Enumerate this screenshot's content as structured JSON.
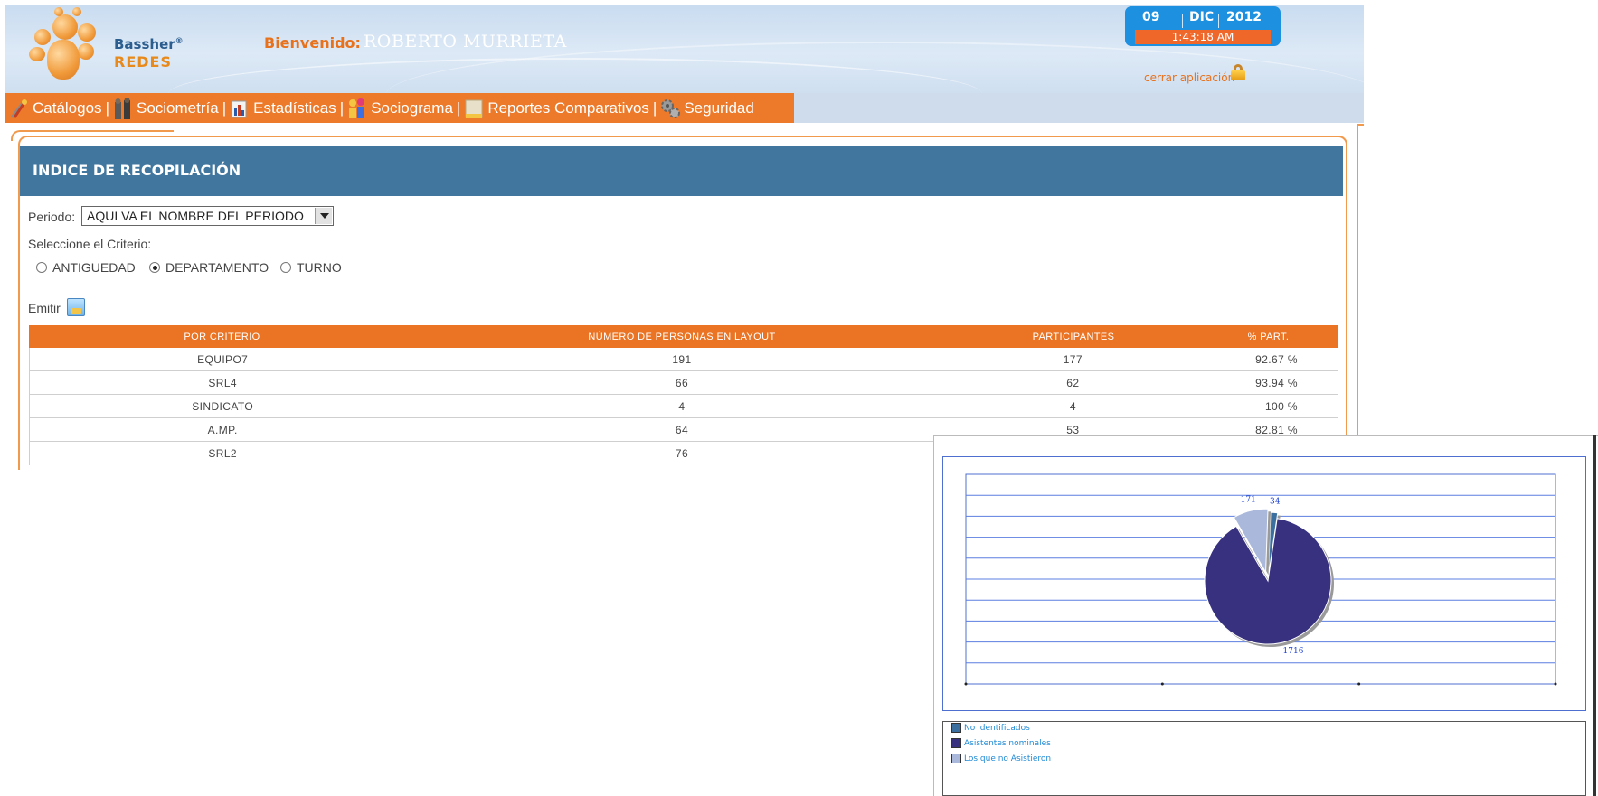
{
  "header": {
    "logo_line1": "Bassher",
    "logo_reg": "®",
    "logo_line2": "REDES",
    "welcome_label": "Bienvenido:",
    "user_name": "ROBERTO MURRIETA",
    "date": {
      "day": "09",
      "month": "DIC",
      "year": "2012",
      "time": "1:43:18 AM"
    },
    "close_label": "cerrar aplicación"
  },
  "nav": {
    "items": [
      {
        "label": "Catálogos",
        "icon": "tools-icon"
      },
      {
        "label": "Sociometría",
        "icon": "people-icon"
      },
      {
        "label": "Estadísticas",
        "icon": "bar-chart-icon"
      },
      {
        "label": "Sociograma",
        "icon": "group-icon"
      },
      {
        "label": "Reportes Comparativos",
        "icon": "report-icon"
      },
      {
        "label": "Seguridad",
        "icon": "gears-icon"
      }
    ]
  },
  "section": {
    "title": "INDICE DE RECOPILACIÓN"
  },
  "form": {
    "period_label": "Periodo:",
    "period_value": "AQUI VA EL NOMBRE DEL PERIODO",
    "criteria_label": "Seleccione el Criterio:",
    "criteria_options": [
      "ANTIGUEDAD",
      "DEPARTAMENTO",
      "TURNO"
    ],
    "criteria_selected": "DEPARTAMENTO",
    "emit_label": "Emitir"
  },
  "table": {
    "headers": [
      "POR CRITERIO",
      "NÚMERO DE PERSONAS EN LAYOUT",
      "PARTICIPANTES",
      "% PART."
    ],
    "rows": [
      [
        "EQUIPO7",
        "191",
        "177",
        "92.67 %"
      ],
      [
        "SRL4",
        "66",
        "62",
        "93.94 %"
      ],
      [
        "SINDICATO",
        "4",
        "4",
        "100 %"
      ],
      [
        "A.MP.",
        "64",
        "53",
        "82.81 %"
      ],
      [
        "SRL2",
        "76",
        "",
        ""
      ]
    ]
  },
  "chart_data": {
    "type": "pie",
    "slices": [
      {
        "label": "No Identificados",
        "value": 34,
        "color": "#3a6fa0"
      },
      {
        "label": "Asistentes nominales",
        "value": 1716,
        "color": "#37317f"
      },
      {
        "label": "Los que no Asistieron",
        "value": 171,
        "color": "#aab8dc"
      }
    ],
    "legend_position": "bottom",
    "grid": true
  },
  "colors": {
    "accent_orange": "#ea7423",
    "section_blue": "#41779f",
    "date_blue": "#1e90e0",
    "time_red": "#f0672a"
  }
}
